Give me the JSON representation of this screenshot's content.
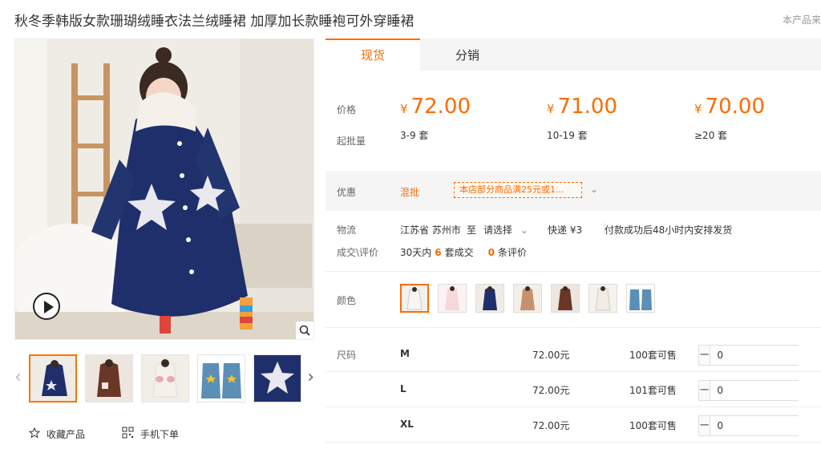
{
  "title": "秋冬季韩版女款珊瑚绒睡衣法兰绒睡裙 加厚加长款睡袍可外穿睡裙",
  "corner_note": "本产品来",
  "tabs": [
    {
      "label": "现货"
    },
    {
      "label": "分销"
    }
  ],
  "price": {
    "label": "价格",
    "batch_label": "起批量",
    "currency": "¥",
    "tiers": [
      {
        "price": "72.00",
        "range": "3-9 套"
      },
      {
        "price": "71.00",
        "range": "10-19 套"
      },
      {
        "price": "70.00",
        "range": "≥20 套"
      }
    ]
  },
  "promo": {
    "label": "优惠",
    "type": "混批",
    "tag": "本店部分商品满25元或1...",
    "chevron": "⌄"
  },
  "logistics": {
    "label": "物流",
    "origin": "江苏省 苏州市",
    "to": "至",
    "destination": "请选择",
    "method": "快递 ¥3",
    "dispatch": "付款成功后48小时内安排发货"
  },
  "deal": {
    "label": "成交\\评价",
    "prefix": "30天内",
    "count": "6",
    "count_suffix": "套成交",
    "reviews": "0",
    "reviews_suffix": "条评价"
  },
  "color": {
    "label": "颜色",
    "swatches": [
      "white",
      "pink",
      "navy",
      "tan",
      "brown",
      "cream",
      "blue"
    ]
  },
  "size": {
    "label": "尺码",
    "rows": [
      {
        "name": "M",
        "price": "72.00元",
        "stock": "100套可售",
        "qty": "0"
      },
      {
        "name": "L",
        "price": "72.00元",
        "stock": "101套可售",
        "qty": "0"
      },
      {
        "name": "XL",
        "price": "72.00元",
        "stock": "100套可售",
        "qty": "0"
      }
    ]
  },
  "actions": {
    "favorite": "收藏产品",
    "mobile_order": "手机下单"
  },
  "icons": {
    "play": "play-icon",
    "zoom": "magnifier-icon",
    "star": "star-icon",
    "qr": "qr-code-icon"
  },
  "colors": {
    "accent": "#ff6a00",
    "robe": "#1f2f6b"
  }
}
